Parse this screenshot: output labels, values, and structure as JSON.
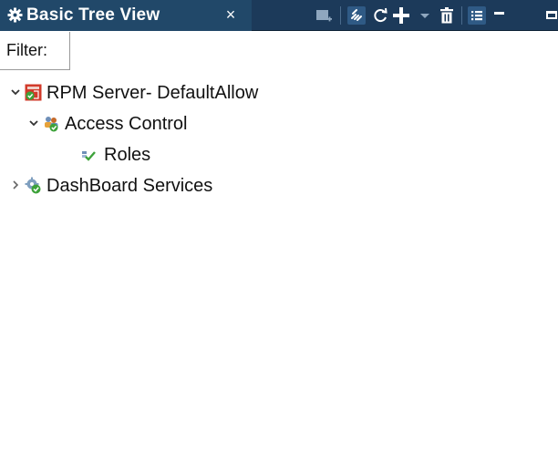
{
  "window": {
    "title": "Basic Tree View",
    "close_glyph": "×"
  },
  "toolbar": {
    "icons": [
      "new-item-icon",
      "link-icon",
      "refresh-icon",
      "add-icon",
      "dropdown-arrow-icon",
      "delete-icon",
      "list-view-icon",
      "minimize-icon",
      "maximize-icon"
    ],
    "accent": "#1c3a5a",
    "tab_color": "#214869"
  },
  "filter": {
    "label": "Filter:",
    "value": "",
    "placeholder": ""
  },
  "tree": {
    "nodes": [
      {
        "label": "RPM Server- DefaultAllow",
        "icon": "server-icon",
        "expanded": true,
        "level": 0
      },
      {
        "label": "Access Control",
        "icon": "access-control-icon",
        "expanded": true,
        "level": 1
      },
      {
        "label": "Roles",
        "icon": "roles-icon",
        "expanded": null,
        "level": 2
      },
      {
        "label": "DashBoard Services",
        "icon": "dashboard-services-icon",
        "expanded": false,
        "level": 0
      }
    ]
  }
}
